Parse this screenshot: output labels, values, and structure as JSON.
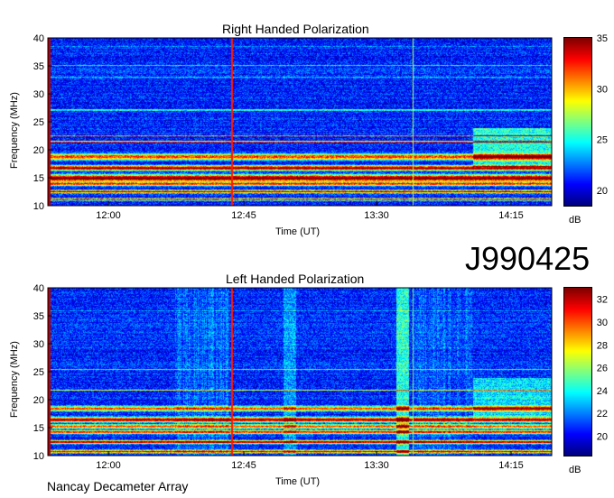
{
  "header": {
    "id_label": "J990425"
  },
  "footer": {
    "label": "Nancay Decameter Array"
  },
  "chart_data": [
    {
      "type": "heatmap",
      "title": "Right Handed Polarization",
      "xlabel": "Time (UT)",
      "ylabel": "Frequency (MHz)",
      "x_ticks": [
        "12:00",
        "12:45",
        "13:30",
        "14:15"
      ],
      "y_ticks": [
        "10",
        "15",
        "20",
        "25",
        "30",
        "35",
        "40"
      ],
      "ylim": [
        10,
        40
      ],
      "colorbar": {
        "label": "dB",
        "ticks": [
          "20",
          "25",
          "30",
          "35"
        ],
        "range": [
          18.5,
          35
        ]
      }
    },
    {
      "type": "heatmap",
      "title": "Left Handed Polarization",
      "xlabel": "Time (UT)",
      "ylabel": "Frequency (MHz)",
      "x_ticks": [
        "12:00",
        "12:45",
        "13:30",
        "14:15"
      ],
      "y_ticks": [
        "10",
        "15",
        "20",
        "25",
        "30",
        "35",
        "40"
      ],
      "ylim": [
        10,
        40
      ],
      "colorbar": {
        "label": "dB",
        "ticks": [
          "20",
          "22",
          "24",
          "26",
          "28",
          "30",
          "32"
        ],
        "range": [
          18.3,
          33
        ]
      }
    }
  ]
}
